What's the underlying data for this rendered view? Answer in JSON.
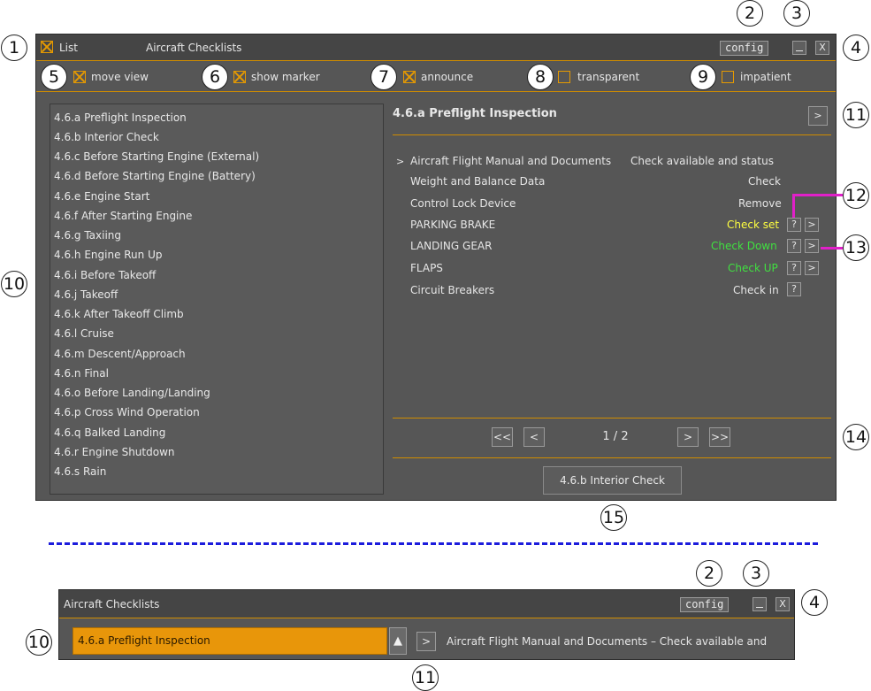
{
  "callouts": [
    "1",
    "2",
    "3",
    "4",
    "5",
    "6",
    "7",
    "8",
    "9",
    "10",
    "11",
    "12",
    "13",
    "14",
    "15"
  ],
  "colors": {
    "accent": "#e69a00",
    "highlight": "#e020c8",
    "check_set": "#ffff40",
    "check_green": "#40e040",
    "divider": "#1c1cdc"
  },
  "main_window": {
    "list_toggle_label": "List",
    "title": "Aircraft Checklists",
    "config_label": "config",
    "minimize_label": "_",
    "close_label": "X",
    "options": [
      {
        "label": "move view",
        "checked": true
      },
      {
        "label": "show marker",
        "checked": true
      },
      {
        "label": "announce",
        "checked": true
      },
      {
        "label": "transparent",
        "checked": false
      },
      {
        "label": "impatient",
        "checked": false
      }
    ],
    "checklists": [
      "4.6.a Preflight Inspection",
      "4.6.b Interior Check",
      "4.6.c Before Starting Engine (External)",
      "4.6.d Before Starting Engine (Battery)",
      "4.6.e Engine Start",
      "4.6.f After Starting Engine",
      "4.6.g Taxiing",
      "4.6.h Engine Run Up",
      "4.6.i Before Takeoff",
      "4.6.j Takeoff",
      "4.6.k After Takeoff Climb",
      "4.6.l Cruise",
      "4.6.m Descent/Approach",
      "4.6.n Final",
      "4.6.o Before Landing/Landing",
      "4.6.p Cross Wind Operation",
      "4.6.q Balked Landing",
      "4.6.r Engine Shutdown",
      "4.6.s Rain"
    ],
    "content_title": "4.6.a Preflight Inspection",
    "next_arrow": ">",
    "current_marker": ">",
    "items": [
      {
        "name": "Aircraft Flight Manual and Documents",
        "value": "Check available and status"
      },
      {
        "name": "Weight and Balance Data",
        "value": "Check"
      },
      {
        "name": "Control Lock Device",
        "value": "Remove"
      },
      {
        "name": "PARKING BRAKE",
        "value": "Check set",
        "help": "?",
        "exec": ">"
      },
      {
        "name": "LANDING GEAR",
        "value": "Check Down",
        "help": "?",
        "exec": ">"
      },
      {
        "name": "FLAPS",
        "value": "Check UP",
        "help": "?",
        "exec": ">"
      },
      {
        "name": "Circuit Breakers",
        "value": "Check in",
        "help": "?"
      }
    ],
    "pager": {
      "first": "<<",
      "prev": "<",
      "text": "1 / 2",
      "next": ">",
      "last": ">>"
    },
    "next_checklist_label": "4.6.b Interior Check"
  },
  "compact_window": {
    "title": "Aircraft Checklists",
    "config_label": "config",
    "minimize_label": "_",
    "close_label": "X",
    "selected_checklist": "4.6.a Preflight Inspection",
    "dropdown_arrow": "▲",
    "next_arrow": ">",
    "current_item_text": "Aircraft Flight Manual and Documents –  Check available and"
  }
}
